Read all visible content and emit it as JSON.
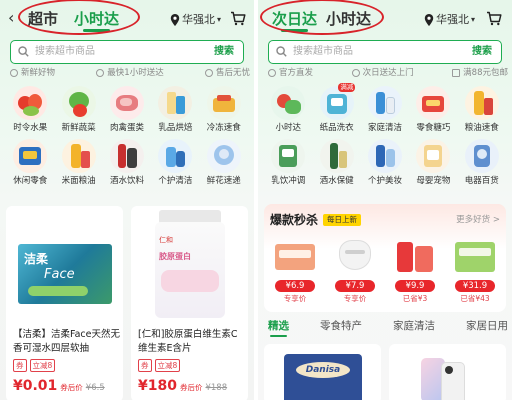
{
  "left": {
    "tabs": [
      "超市",
      "小时达"
    ],
    "location": "华强北",
    "search_placeholder": "搜索超市商品",
    "search_button": "搜索",
    "badges": [
      "新鲜好物",
      "最快1小时送达",
      "售后无忧"
    ],
    "categories": [
      {
        "label": "时令水果",
        "icon": "fruit-icon"
      },
      {
        "label": "新鲜蔬菜",
        "icon": "vegetable-icon"
      },
      {
        "label": "肉禽蛋类",
        "icon": "meat-icon"
      },
      {
        "label": "乳品烘焙",
        "icon": "dairy-icon"
      },
      {
        "label": "冷冻速食",
        "icon": "frozen-food-icon"
      },
      {
        "label": "休闲零食",
        "icon": "snack-icon"
      },
      {
        "label": "米面粮油",
        "icon": "grain-oil-icon"
      },
      {
        "label": "酒水饮料",
        "icon": "drinks-icon"
      },
      {
        "label": "个护清洁",
        "icon": "personal-care-icon"
      },
      {
        "label": "鲜花速递",
        "icon": "flower-icon"
      }
    ],
    "products": [
      {
        "title": "【洁柔】洁柔Face天然无香可湿水四层软抽",
        "coupon": "券",
        "promo": "立减8",
        "price": "¥0.01",
        "after": "券后价",
        "old": "¥6.5",
        "brand": "洁柔",
        "brand_sub": "Face"
      },
      {
        "title": "[仁和]胶原蛋白维生素C维生素E含片",
        "coupon": "券",
        "promo": "立减8",
        "price": "¥180",
        "after": "券后价",
        "old": "¥188",
        "brand": "仁和",
        "brand_sub": "胶原蛋白"
      }
    ],
    "colors": {
      "accent": "#1a9e4b",
      "price": "#e1262d",
      "highlight": "#d8232a"
    }
  },
  "right": {
    "tabs": [
      "次日达",
      "小时达"
    ],
    "location": "华强北",
    "search_placeholder": "搜索超市商品",
    "search_button": "搜索",
    "badges": [
      "官方直发",
      "次日送达上门",
      "满88元包邮"
    ],
    "categories": [
      {
        "label": "小时达",
        "icon": "hourly-delivery-icon",
        "tag": ""
      },
      {
        "label": "纸品洗衣",
        "icon": "paper-laundry-icon",
        "tag": "满减"
      },
      {
        "label": "家庭清洁",
        "icon": "home-cleaning-icon",
        "tag": ""
      },
      {
        "label": "零食糖巧",
        "icon": "candy-icon",
        "tag": ""
      },
      {
        "label": "粮油速食",
        "icon": "grain-icon",
        "tag": ""
      },
      {
        "label": "乳饮冲调",
        "icon": "milk-drink-icon",
        "tag": ""
      },
      {
        "label": "酒水保健",
        "icon": "wine-health-icon",
        "tag": ""
      },
      {
        "label": "个护美妆",
        "icon": "cosmetics-icon",
        "tag": ""
      },
      {
        "label": "母婴宠物",
        "icon": "baby-pet-icon",
        "tag": ""
      },
      {
        "label": "电器百货",
        "icon": "appliance-icon",
        "tag": ""
      }
    ],
    "flash_sale": {
      "title": "爆款秒杀",
      "badge": "每日上新",
      "more": "更多好货 >",
      "items": [
        {
          "price": "¥6.9",
          "sub": "专享价"
        },
        {
          "price": "¥7.9",
          "sub": "专享价"
        },
        {
          "price": "¥9.9",
          "sub": "已省¥3"
        },
        {
          "price": "¥31.9",
          "sub": "已省¥43"
        }
      ]
    },
    "feed_tabs": [
      "精选",
      "零食特产",
      "家庭清洁",
      "家居日用"
    ],
    "bottom_cards": [
      {
        "label": "Danisa"
      },
      {
        "label": "phone"
      }
    ]
  }
}
